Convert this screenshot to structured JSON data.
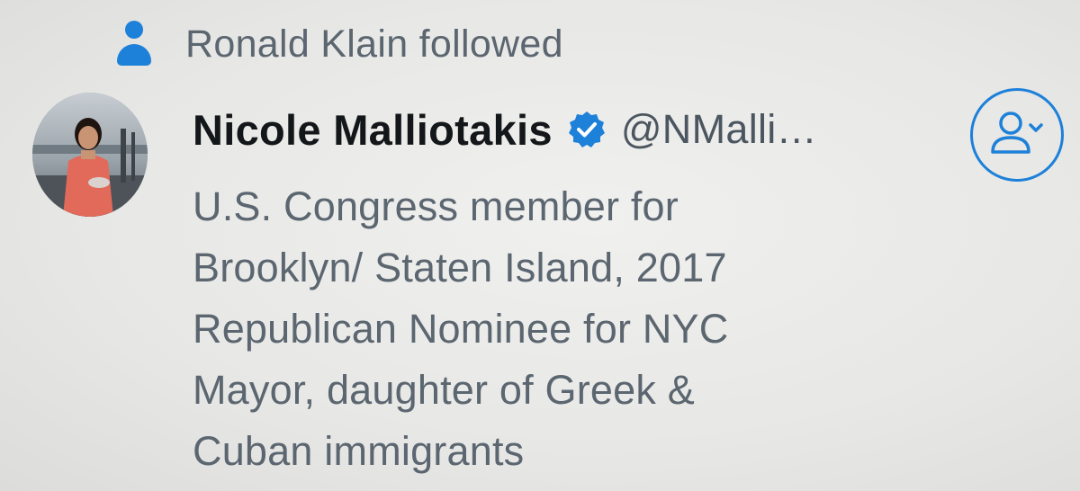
{
  "social_context": {
    "icon": "person-icon",
    "text": "Ronald Klain followed"
  },
  "user": {
    "avatar": "profile-photo",
    "display_name": "Nicole Malliotakis",
    "verified_icon": "verified-badge-icon",
    "handle": "@NMalli…",
    "bio_lines": [
      "U.S. Congress member for",
      "Brooklyn/ Staten Island, 2017",
      "Republican Nominee for NYC",
      "Mayor, daughter of Greek &",
      "Cuban immigrants"
    ]
  },
  "follow_button": {
    "icon": "follow-user-icon"
  },
  "colors": {
    "accent": "#1d80d9",
    "name_text": "#14171a",
    "secondary_text": "#5b6670",
    "background": "#e9e9e7"
  }
}
